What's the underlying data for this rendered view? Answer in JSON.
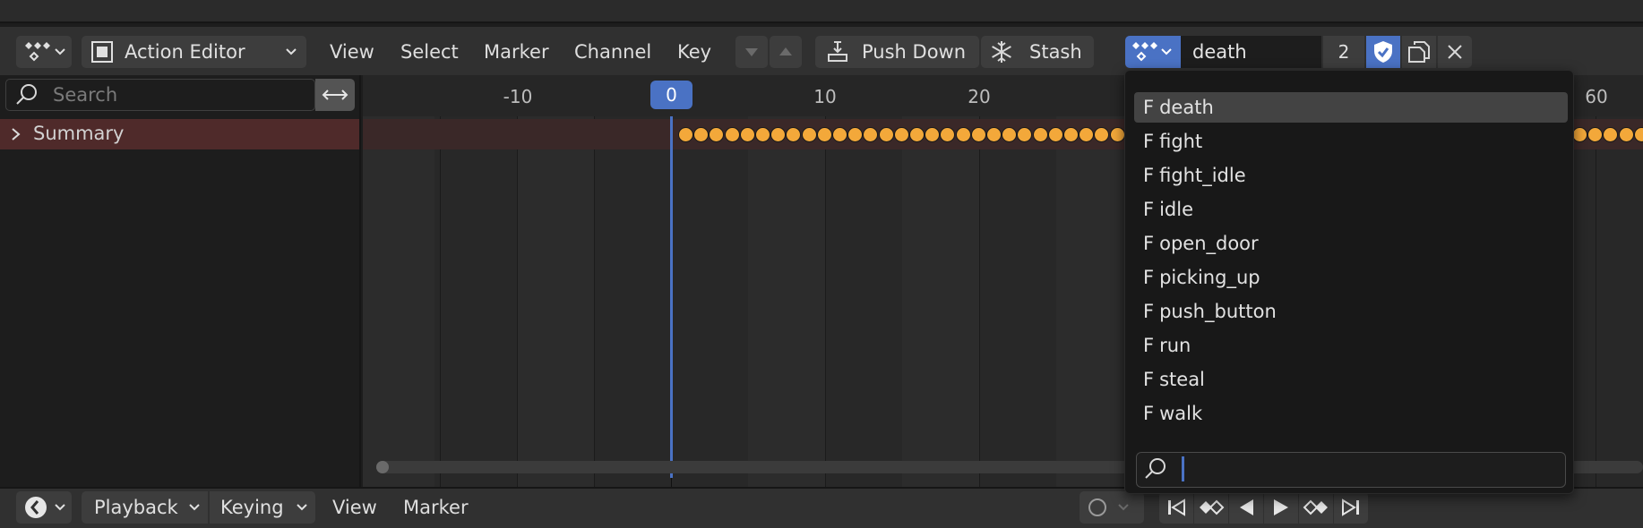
{
  "header": {
    "editor_type_icon": "dopesheet-icon",
    "mode_label": "Action Editor",
    "menus": [
      "View",
      "Select",
      "Marker",
      "Channel",
      "Key"
    ],
    "push_down_label": "Push Down",
    "stash_label": "Stash",
    "action_name": "death",
    "action_users": "2"
  },
  "channels": {
    "search_placeholder": "Search",
    "summary_label": "Summary"
  },
  "ruler": {
    "ticks": [
      "-10",
      "10",
      "20",
      "60"
    ],
    "current_frame": "0"
  },
  "action_dropdown": {
    "items": [
      {
        "prefix": "F",
        "name": "death"
      },
      {
        "prefix": "F",
        "name": "fight"
      },
      {
        "prefix": "F",
        "name": "fight_idle"
      },
      {
        "prefix": "F",
        "name": "idle"
      },
      {
        "prefix": "F",
        "name": "open_door"
      },
      {
        "prefix": "F",
        "name": "picking_up"
      },
      {
        "prefix": "F",
        "name": "push_button"
      },
      {
        "prefix": "F",
        "name": "run"
      },
      {
        "prefix": "F",
        "name": "steal"
      },
      {
        "prefix": "F",
        "name": "walk"
      }
    ],
    "search_value": ""
  },
  "footer": {
    "playback_label": "Playback",
    "keying_label": "Keying",
    "view_label": "View",
    "marker_label": "Marker"
  },
  "colors": {
    "accent": "#4a72c4",
    "keyframe": "#f3a83a",
    "summary_bg": "#4f2a2a"
  }
}
